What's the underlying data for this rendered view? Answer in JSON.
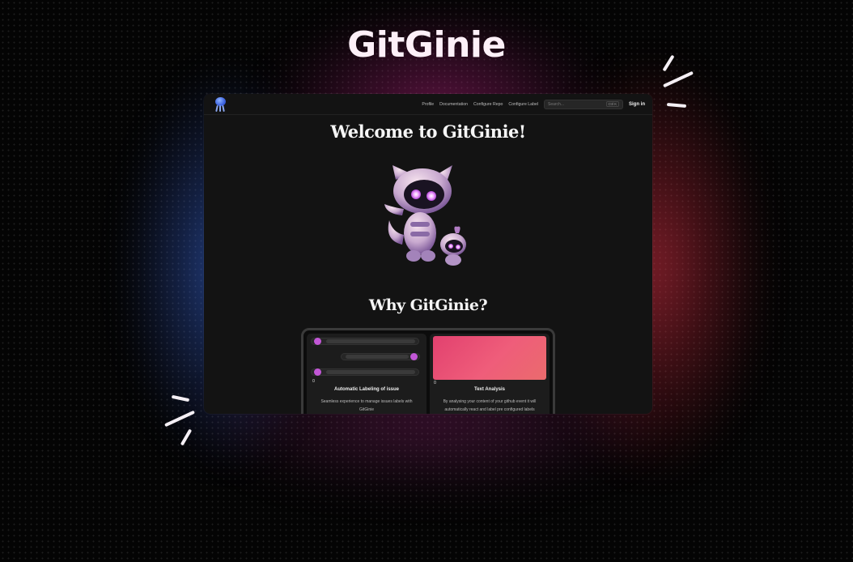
{
  "hero": {
    "title": "GitGinie"
  },
  "nav": {
    "links": [
      "Profile",
      "Documentation",
      "Configure Repo",
      "Configure Label"
    ],
    "search_placeholder": "Search...",
    "search_shortcut": "Ctrl K",
    "signin_label": "Sign in"
  },
  "main": {
    "welcome_title": "Welcome to GitGinie!",
    "why_title": "Why GitGinie?"
  },
  "features": [
    {
      "title": "Automatic Labeling of issue",
      "description": "Seamless experience to manage issues labels with GitGinie"
    },
    {
      "title": "Text Analysis",
      "description": "By analysing your content of your github event it will automatically react and label pre configured labels"
    }
  ],
  "colors": {
    "accent_purple": "#c257d6",
    "gradient_start": "#e2416f",
    "gradient_end": "#ea6b6d",
    "logo_blue": "#3d63e0"
  },
  "icons": [
    "octopus-logo-icon",
    "mascot-robot-illustration",
    "sparkle-icon"
  ]
}
